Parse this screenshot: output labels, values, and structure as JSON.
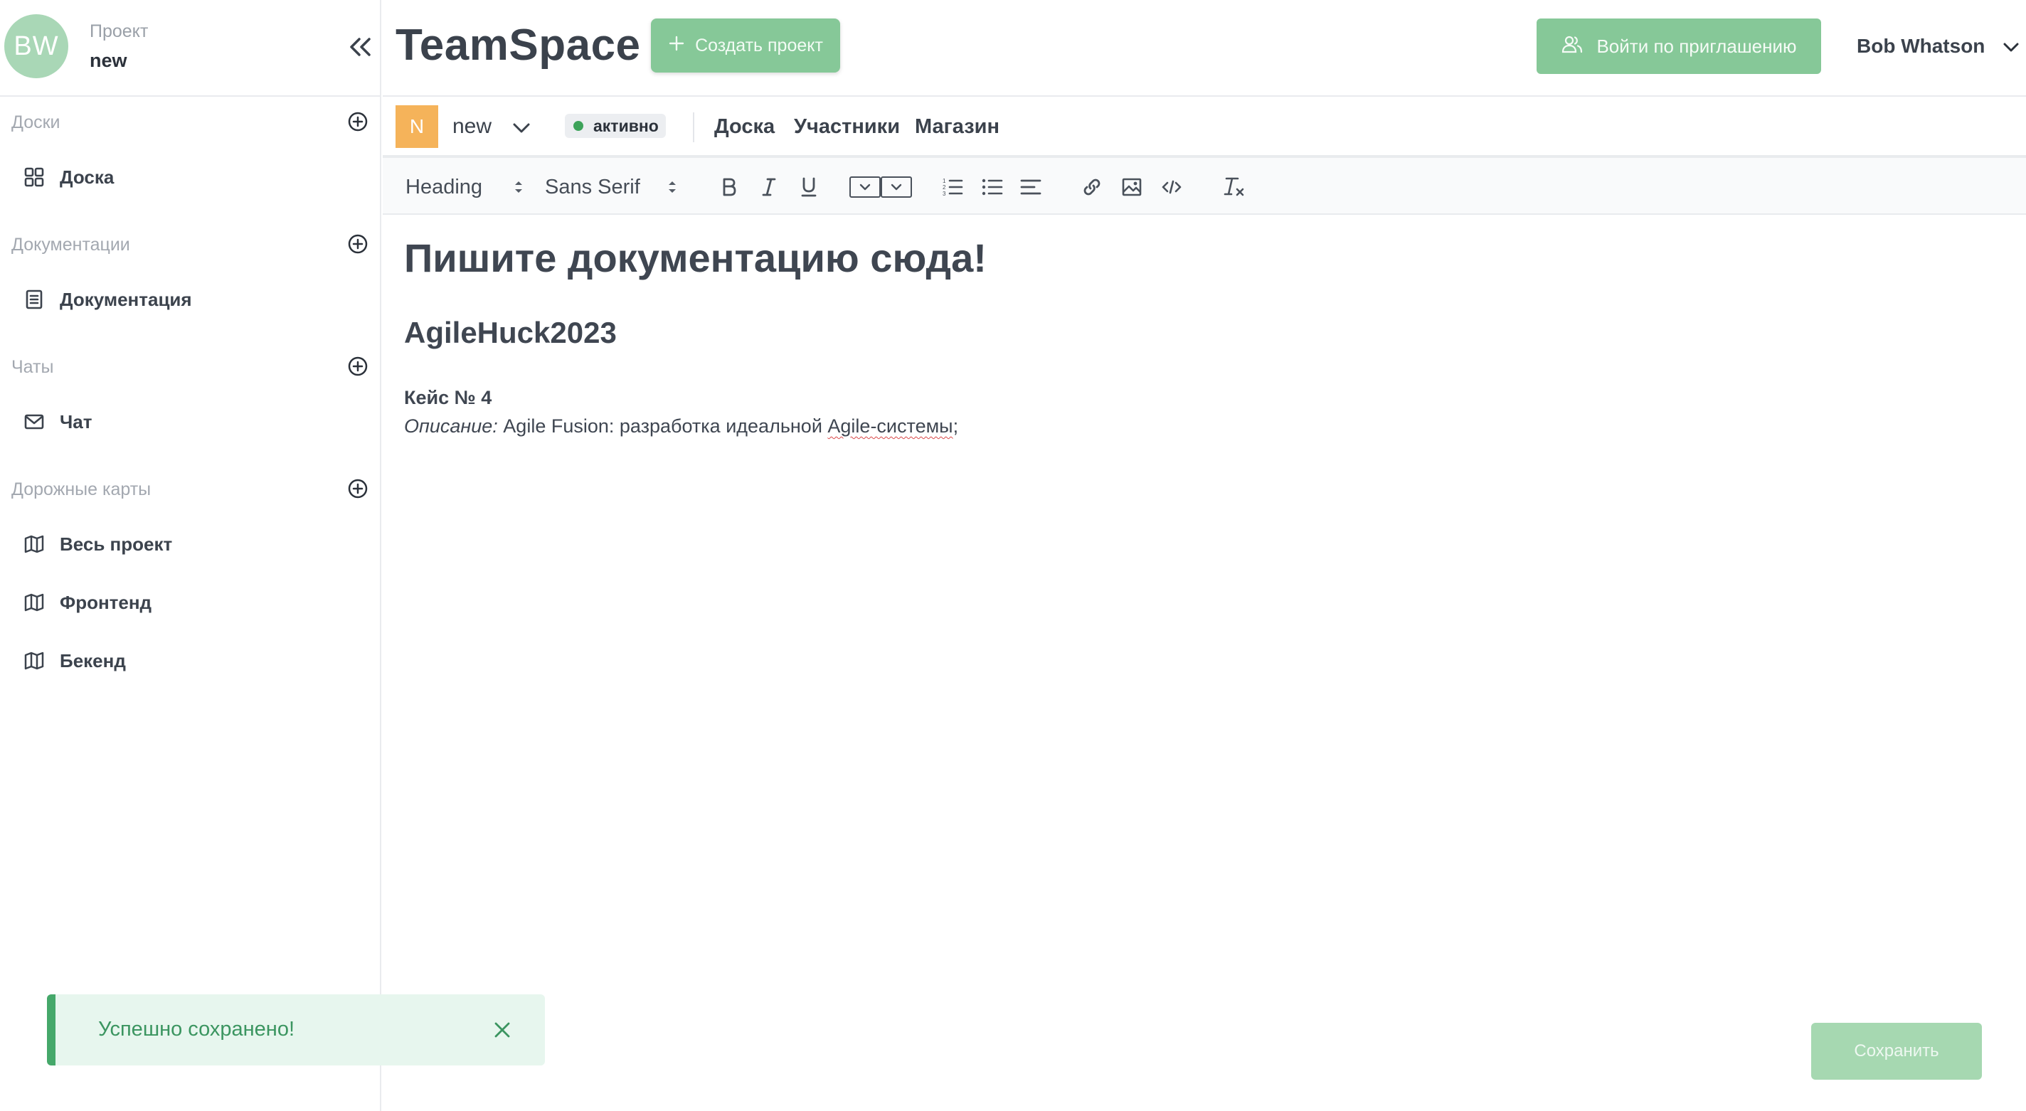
{
  "app": {
    "title": "TeamSpace"
  },
  "colors": {
    "accent": "#86c898",
    "project_badge": "#f5b35a",
    "status_dot": "#3da35a",
    "toast_bar": "#45a86a"
  },
  "sidebar": {
    "avatar_initials": "BW",
    "project_caption": "Проект",
    "project_name": "new",
    "collapse_icon": "double-chevron-left-icon",
    "sections": [
      {
        "title": "Доски",
        "items": [
          {
            "label": "Доска",
            "icon": "grid-icon"
          }
        ]
      },
      {
        "title": "Документации",
        "items": [
          {
            "label": "Документация",
            "icon": "document-icon"
          }
        ]
      },
      {
        "title": "Чаты",
        "items": [
          {
            "label": "Чат",
            "icon": "mail-icon"
          }
        ]
      },
      {
        "title": "Дорожные карты",
        "items": [
          {
            "label": "Весь проект",
            "icon": "map-icon"
          },
          {
            "label": "Фронтенд",
            "icon": "map-icon"
          },
          {
            "label": "Бекенд",
            "icon": "map-icon"
          }
        ]
      }
    ]
  },
  "header": {
    "create_project_label": "Создать проект",
    "invite_label": "Войти по приглашению",
    "user_name": "Bob Whatson"
  },
  "project_bar": {
    "badge_letter": "N",
    "project_name": "new",
    "status": "активно",
    "tabs": [
      "Доска",
      "Участники",
      "Магазин"
    ]
  },
  "editor": {
    "toolbar": {
      "heading_select": "Heading",
      "font_select": "Sans Serif",
      "buttons": [
        "bold-icon",
        "italic-icon",
        "underline-icon",
        "color-select-icon",
        "background-select-icon",
        "ordered-list-icon",
        "bullet-list-icon",
        "align-left-icon",
        "link-icon",
        "image-icon",
        "code-icon",
        "clear-format-icon"
      ]
    },
    "content": {
      "h1": "Пишите документацию сюда!",
      "h2": "AgileHuck2023",
      "case_title": "Кейс № 4",
      "description_label": "Описание:",
      "description_text_before": " Agile Fusion: разработка идеальной ",
      "description_misspelled": "Agile-системы",
      "description_text_after": ";"
    }
  },
  "toast": {
    "message": "Успешно сохранено!"
  },
  "save_label": "Сохранить"
}
